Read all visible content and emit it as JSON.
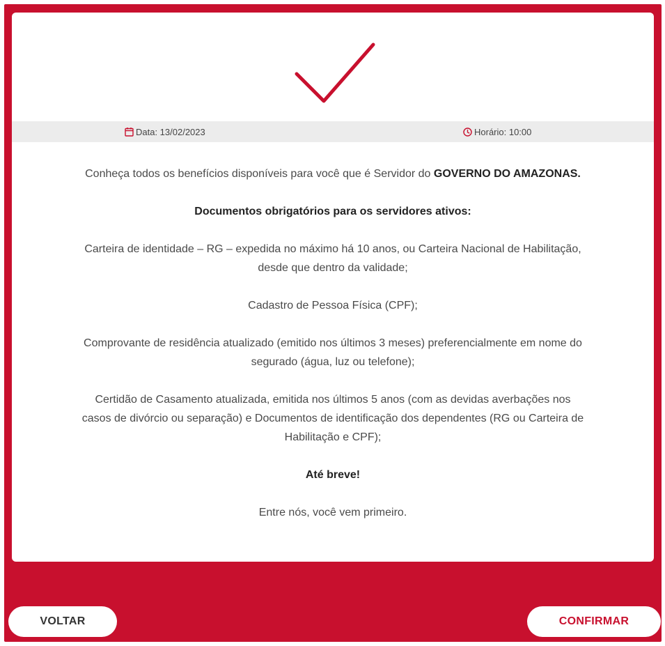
{
  "colors": {
    "brand": "#c8102e",
    "info_bar": "#ececec",
    "text": "#4a4a4a"
  },
  "icons": {
    "check": "checkmark-icon",
    "date": "calendar-icon",
    "time": "clock-icon"
  },
  "info": {
    "date_label": "Data: 13/02/2023",
    "time_label": "Horário: 10:00"
  },
  "message": {
    "intro_text": "Conheça todos os benefícios disponíveis para você que é Servidor do ",
    "intro_bold": "GOVERNO DO AMAZONAS.",
    "docs_heading": "Documentos obrigatórios para os servidores ativos:",
    "doc_1_line_1": "Carteira de identidade – RG – expedida no máximo há 10 anos, ou Carteira Nacional de Habilitação,",
    "doc_1_line_2": "desde que dentro da validade;",
    "doc_2": "Cadastro de Pessoa Física (CPF);",
    "doc_3_line_1": "Comprovante de residência atualizado (emitido nos últimos 3 meses) preferencialmente em nome do",
    "doc_3_line_2": "segurado (água, luz ou telefone);",
    "doc_4_line_1": "Certidão de Casamento atualizada, emitida nos últimos 5 anos (com as devidas averbações nos",
    "doc_4_line_2": "casos de divórcio ou separação) e Documentos de identificação dos dependentes (RG ou Carteira de",
    "doc_4_line_3": "Habilitação e CPF);",
    "farewell": "Até breve!",
    "slogan": "Entre nós, você vem primeiro."
  },
  "buttons": {
    "back_label": "VOLTAR",
    "confirm_label": "CONFIRMAR"
  }
}
